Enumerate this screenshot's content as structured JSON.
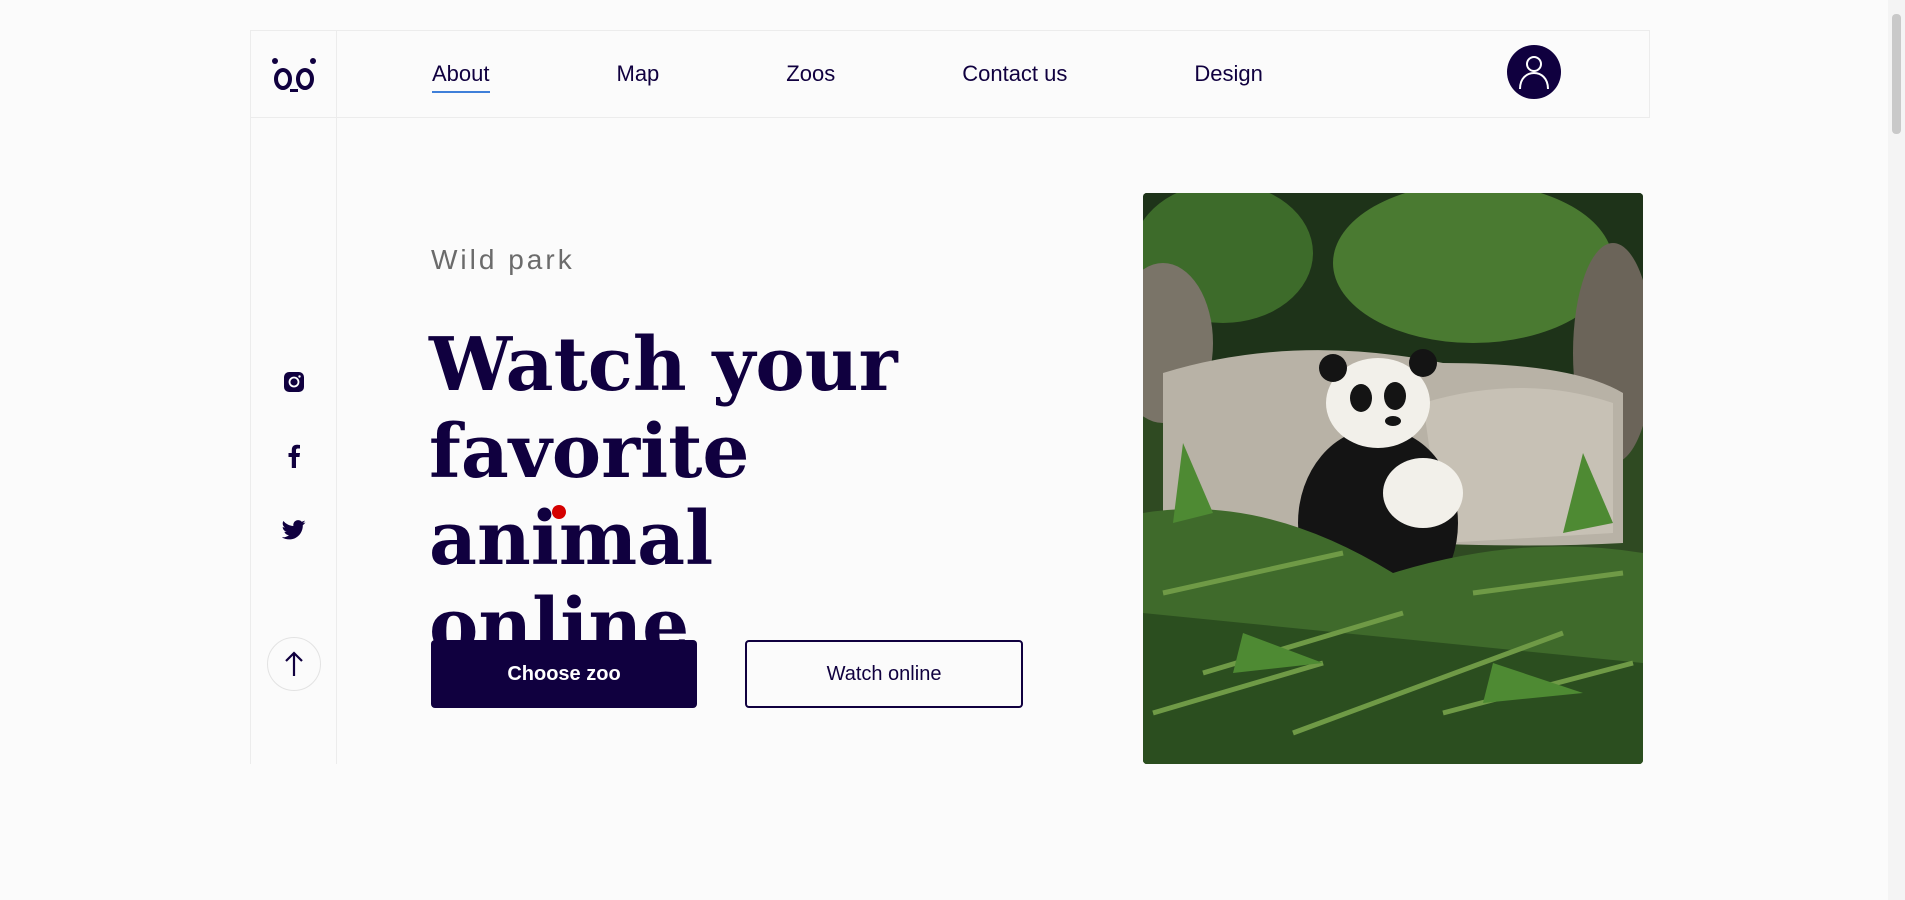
{
  "brand": {
    "logo_text": "o_o"
  },
  "nav": {
    "items": [
      {
        "label": "About",
        "active": true
      },
      {
        "label": "Map",
        "active": false
      },
      {
        "label": "Zoos",
        "active": false
      },
      {
        "label": "Contact us",
        "active": false
      },
      {
        "label": "Design",
        "active": false
      }
    ]
  },
  "hero": {
    "eyebrow": "Wild park",
    "headline_line1": "Watch your",
    "headline_line2": "favorite animal",
    "headline_line3": "online",
    "primary_button": "Choose zoo",
    "secondary_button": "Watch online"
  },
  "social": [
    "instagram-icon",
    "facebook-icon",
    "twitter-icon"
  ],
  "colors": {
    "brand_dark": "#10003f",
    "accent_underline": "#3f7fd9",
    "dot_red": "#d50000",
    "background": "#fbfbfb"
  }
}
